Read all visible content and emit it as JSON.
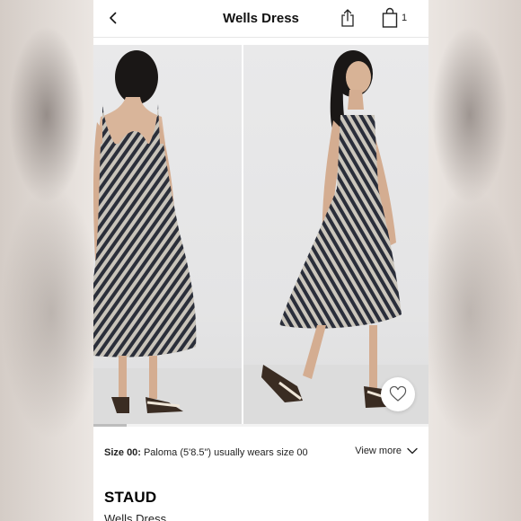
{
  "header": {
    "title": "Wells Dress",
    "bag_count": "1"
  },
  "icons": {
    "back": "chevron-left-icon",
    "share": "share-icon",
    "bag": "shopping-bag-icon",
    "favorite": "heart-icon",
    "view_more": "chevron-down-icon"
  },
  "gallery": {
    "images": [
      {
        "name": "model-back-view"
      },
      {
        "name": "model-side-view"
      }
    ],
    "scroll_position": 0.1
  },
  "size_info": {
    "label": "Size 00:",
    "text": "Paloma (5'8.5\") usually wears size 00",
    "view_more": "View more"
  },
  "product": {
    "brand": "STAUD",
    "name": "Wells Dress"
  },
  "colors": {
    "text": "#111111",
    "background": "#ffffff",
    "divider": "#e6e6e6"
  }
}
